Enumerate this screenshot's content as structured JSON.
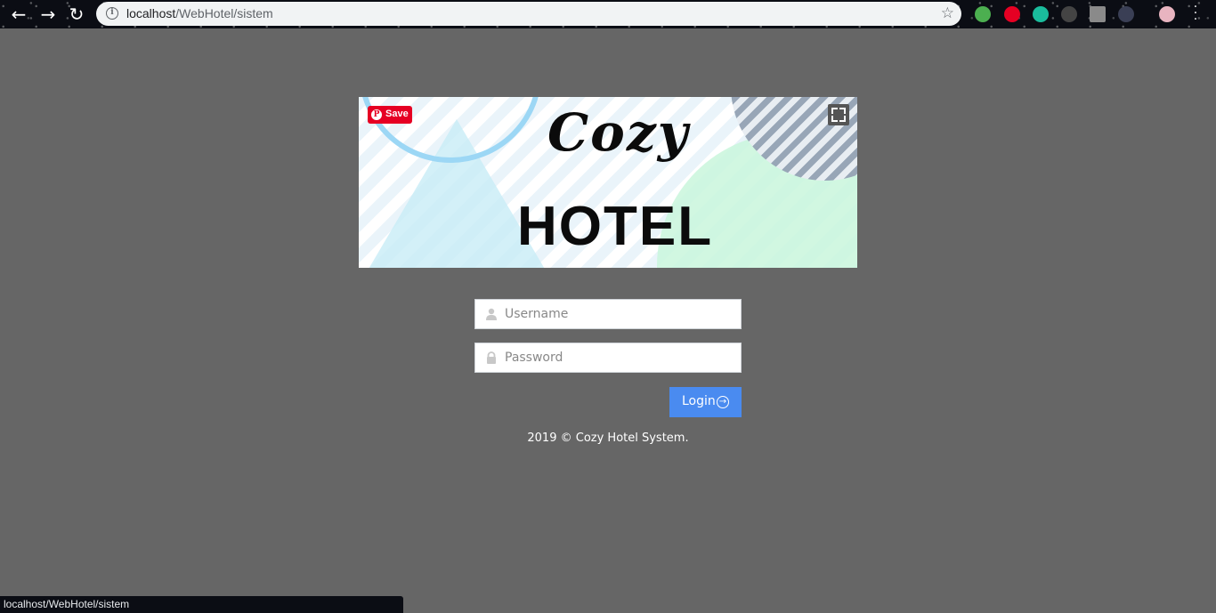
{
  "browser": {
    "url_host": "localhost",
    "url_path": "/WebHotel/sistem",
    "nav_back_icon": "arrow-left-icon",
    "nav_forward_icon": "arrow-right-icon",
    "nav_reload_icon": "reload-icon",
    "star_icon": "bookmark-star-icon",
    "status_url": "localhost/WebHotel/sistem",
    "extensions": [
      {
        "name": "globe-extension-icon",
        "color": "#4caf50"
      },
      {
        "name": "pinterest-extension-icon",
        "color": "#e60023"
      },
      {
        "name": "m-extension-icon",
        "color": "#1abc9c"
      },
      {
        "name": "dark-extension-icon",
        "color": "#444444"
      },
      {
        "name": "v-extension-icon",
        "color": "#8a8a8a"
      },
      {
        "name": "circle-extension-icon",
        "color": "#3a3f55"
      },
      {
        "name": "profile-avatar-icon",
        "color": "#e8b4c0"
      }
    ]
  },
  "banner": {
    "script_title": "Cozy",
    "main_title": "HOTEL",
    "pin_save_label": "Save",
    "pin_logo_glyph": "P"
  },
  "login": {
    "username_placeholder": "Username",
    "password_placeholder": "Password",
    "login_label": "Login",
    "username_icon": "user-icon",
    "password_icon": "lock-icon",
    "login_icon": "arrow-circle-right-icon"
  },
  "footer": {
    "text": "2019 © Cozy Hotel System."
  },
  "colors": {
    "page_bg": "#666666",
    "login_button": "#4a8bf0",
    "pinterest": "#e60023"
  }
}
